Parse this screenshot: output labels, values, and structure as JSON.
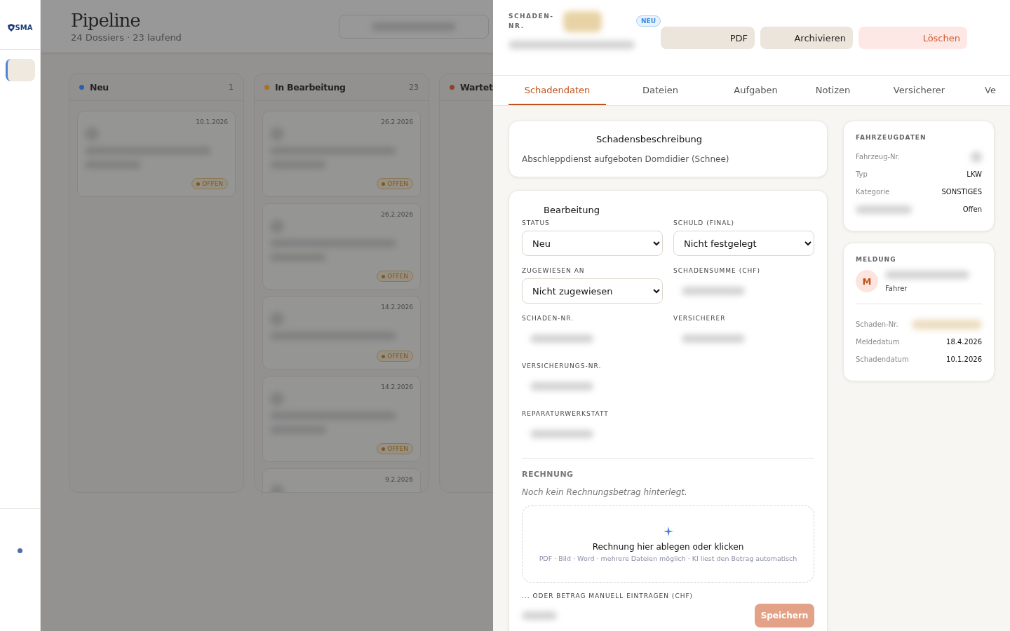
{
  "sidebar": {
    "logo": "SMA",
    "items": [
      {
        "selected": true
      }
    ]
  },
  "pipeline": {
    "title": "Pipeline",
    "subtitle": "24 Dossiers · 23 laufend",
    "columns": [
      {
        "title": "Neu",
        "count": "1",
        "color": "#2d5fae",
        "cards": [
          {
            "date": "10.1.2026",
            "badge": "OFFEN"
          }
        ]
      },
      {
        "title": "In Bearbeitung",
        "count": "23",
        "color": "#a8721c",
        "cards": [
          {
            "date": "26.2.2026",
            "badge": "OFFEN"
          },
          {
            "date": "26.2.2026",
            "badge": "OFFEN"
          },
          {
            "date": "14.2.2026",
            "badge": "OFFEN"
          },
          {
            "date": "14.2.2026",
            "badge": "OFFEN"
          },
          {
            "date": "9.2.2026"
          }
        ]
      },
      {
        "title": "Wartet",
        "color": "#8f4420"
      }
    ]
  },
  "drawer": {
    "label": "SCHADEN-NR.",
    "badge": "NEU",
    "buttons": [
      {
        "label": "PDF",
        "kind": "neutral"
      },
      {
        "label": "Archivieren",
        "kind": "neutral"
      },
      {
        "label": "Löschen",
        "kind": "danger"
      }
    ],
    "tabs": [
      {
        "label": "Schadendaten",
        "selected": true
      },
      {
        "label": "Dateien",
        "selected": false
      },
      {
        "label": "Aufgaben",
        "selected": false
      },
      {
        "label": "Notizen",
        "selected": false
      },
      {
        "label": "Versicherer",
        "selected": false
      },
      {
        "label": "Ve",
        "selected": false
      }
    ],
    "description": {
      "title": "Schadensbeschreibung",
      "text": "Abschleppdienst aufgeboten Domdidier (Schnee)"
    },
    "processing": {
      "title": "Bearbeitung",
      "fields": [
        {
          "label": "STATUS",
          "kind": "select",
          "value": "Neu"
        },
        {
          "label": "SCHULD (FINAL)",
          "kind": "select",
          "value": "Nicht festgelegt"
        },
        {
          "label": "ZUGEWIESEN AN",
          "kind": "select",
          "value": "Nicht zugewiesen"
        },
        {
          "label": "SCHADENSUMME (CHF)",
          "kind": "hidden"
        },
        {
          "label": "SCHADEN-NR.",
          "kind": "hidden"
        },
        {
          "label": "VERSICHERER",
          "kind": "hidden"
        },
        {
          "label": "VERSICHERUNGS-NR.",
          "kind": "hidden"
        },
        {
          "label": "REPARATURWERKSTATT",
          "kind": "hidden"
        }
      ]
    },
    "invoice": {
      "title": "RECHNUNG",
      "note": "Noch kein Rechnungsbetrag hinterlegt.",
      "drop_title": "Rechnung hier ablegen oder klicken",
      "drop_hint": "PDF · Bild · Word · mehrere Dateien möglich · KI liest den Betrag automatisch",
      "manual_label": "... ODER BETRAG MANUELL EINTRAGEN (CHF)",
      "save": "Speichern"
    },
    "vehicle": {
      "title": "FAHRZEUGDATEN",
      "rows": [
        {
          "label": "Fahrzeug-Nr."
        },
        {
          "label": "Typ",
          "value": "LKW"
        },
        {
          "label": "Kategorie",
          "value": "SONSTIGES"
        },
        {
          "value": "Offen"
        }
      ]
    },
    "report": {
      "title": "MELDUNG",
      "initial": "M",
      "role": "Fahrer",
      "rows": [
        {
          "label": "Schaden-Nr."
        },
        {
          "label": "Meldedatum",
          "value": "18.4.2026"
        },
        {
          "label": "Schadendatum",
          "value": "10.1.2026"
        }
      ]
    }
  }
}
